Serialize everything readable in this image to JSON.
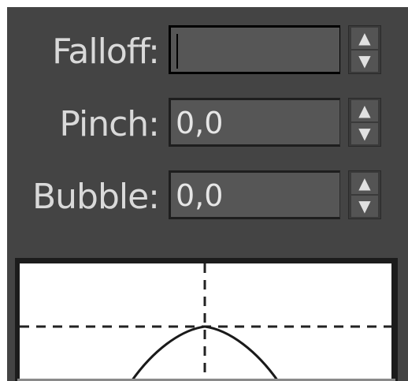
{
  "falloff": {
    "label": "Falloff:",
    "value": ""
  },
  "pinch": {
    "label": "Pinch:",
    "value": "0,0"
  },
  "bubble": {
    "label": "Bubble:",
    "value": "0,0"
  },
  "spinner": {
    "up_glyph": "▲",
    "down_glyph": "▼"
  },
  "colors": {
    "panel_bg": "#444444",
    "field_bg": "#565656",
    "label_text": "#d9d9d9",
    "graph_bg": "#ffffff"
  }
}
